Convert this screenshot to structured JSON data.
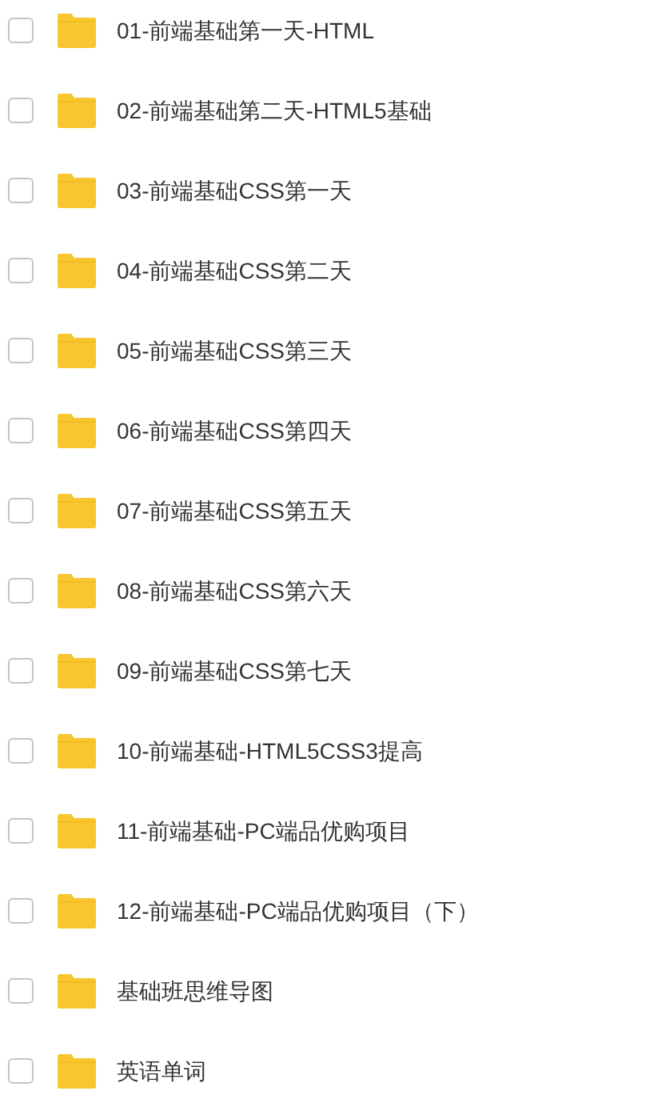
{
  "folders": [
    {
      "name": "01-前端基础第一天-HTML",
      "checked": false
    },
    {
      "name": "02-前端基础第二天-HTML5基础",
      "checked": false
    },
    {
      "name": "03-前端基础CSS第一天",
      "checked": false
    },
    {
      "name": "04-前端基础CSS第二天",
      "checked": false
    },
    {
      "name": "05-前端基础CSS第三天",
      "checked": false
    },
    {
      "name": "06-前端基础CSS第四天",
      "checked": false
    },
    {
      "name": "07-前端基础CSS第五天",
      "checked": false
    },
    {
      "name": "08-前端基础CSS第六天",
      "checked": false
    },
    {
      "name": "09-前端基础CSS第七天",
      "checked": false
    },
    {
      "name": "10-前端基础-HTML5CSS3提高",
      "checked": false
    },
    {
      "name": "11-前端基础-PC端品优购项目",
      "checked": false
    },
    {
      "name": "12-前端基础-PC端品优购项目（下）",
      "checked": false
    },
    {
      "name": "基础班思维导图",
      "checked": false
    },
    {
      "name": "英语单词",
      "checked": false
    }
  ]
}
